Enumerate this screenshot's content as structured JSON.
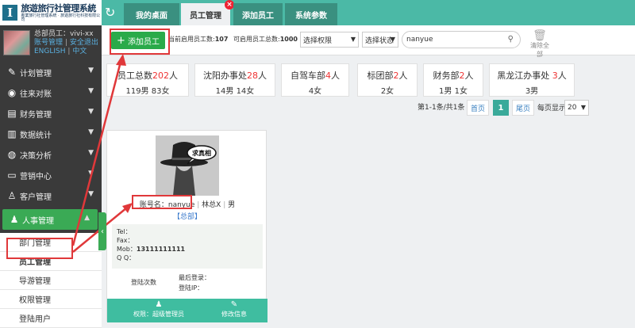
{
  "logo": {
    "mark": "I",
    "title": "旅遊旅行社管理系統",
    "subtitle": "專業旅行社管理系統 · 旅遊旅行社科技有限公司"
  },
  "profile": {
    "name": "总部员工：vivi-xx",
    "account_link": "账号管理",
    "separator": "|",
    "logout_link": "安全退出",
    "lang_en": "ENGLISH",
    "lang_cn": "中文"
  },
  "menu": [
    {
      "label": "计划管理",
      "icon": "edit-icon"
    },
    {
      "label": "往来对账",
      "icon": "coins-icon"
    },
    {
      "label": "财务管理",
      "icon": "money-icon"
    },
    {
      "label": "数据统计",
      "icon": "chart-icon"
    },
    {
      "label": "决策分析",
      "icon": "globe-icon"
    },
    {
      "label": "营销中心",
      "icon": "monitor-icon"
    },
    {
      "label": "客户管理",
      "icon": "user-plus-icon"
    },
    {
      "label": "人事管理",
      "icon": "person-icon"
    }
  ],
  "submenu": [
    "部门管理",
    "员工管理",
    "导游管理",
    "权限管理",
    "登陆用户"
  ],
  "tabs": [
    {
      "label": "我的桌面"
    },
    {
      "label": "员工管理"
    },
    {
      "label": "添加员工"
    },
    {
      "label": "系统参数"
    }
  ],
  "tab_close": "×",
  "toolbar": {
    "add_label": "添加员工",
    "enabled_label": "当前启用员工数:",
    "enabled_count": "107",
    "available_label": "可启用员工总数:",
    "available_count": "1000",
    "perm_select": "选择权限",
    "status_select": "选择状态",
    "search_value": "nanyue",
    "clear_label": "清除全部"
  },
  "departments": [
    {
      "name": "员工总数",
      "count": "202",
      "unit": "人",
      "detail": "119男 83女"
    },
    {
      "name": "沈阳办事处",
      "count": "28",
      "unit": "人",
      "detail": "14男 14女"
    },
    {
      "name": "自驾车部",
      "count": "4",
      "unit": "人",
      "detail": "4女"
    },
    {
      "name": "标团部",
      "count": "2",
      "unit": "人",
      "detail": "2女"
    },
    {
      "name": "财务部",
      "count": "2",
      "unit": "人",
      "detail": "1男 1女"
    },
    {
      "name": "黑龙江办事处 ",
      "count": "3",
      "unit": "人",
      "detail": "3男"
    }
  ],
  "pager": {
    "info": "第1-1条/共1条",
    "first": "首页",
    "current": "1",
    "last": "尾页",
    "size_label": "每页显示:",
    "size": "20"
  },
  "card": {
    "photo_text": "求真相",
    "account": "账号名：nanyue",
    "sep1": "|",
    "realname": "林总X",
    "sep2": "|",
    "gender": "男",
    "role": "【总部】",
    "tel": "Tel：",
    "fax": "Fax：",
    "mob_label": "Mob：",
    "mob_value": "13111111111",
    "qq": "Q Q：",
    "login_count": "登陆次数",
    "last_login": "最后登录：",
    "login_ip": "登陆IP：",
    "perm": "权限：超级管理员",
    "edit": "修改信息"
  },
  "colors": {
    "accent": "#3aaa55",
    "teal": "#4bb9a6",
    "highlight": "#e0383a"
  }
}
